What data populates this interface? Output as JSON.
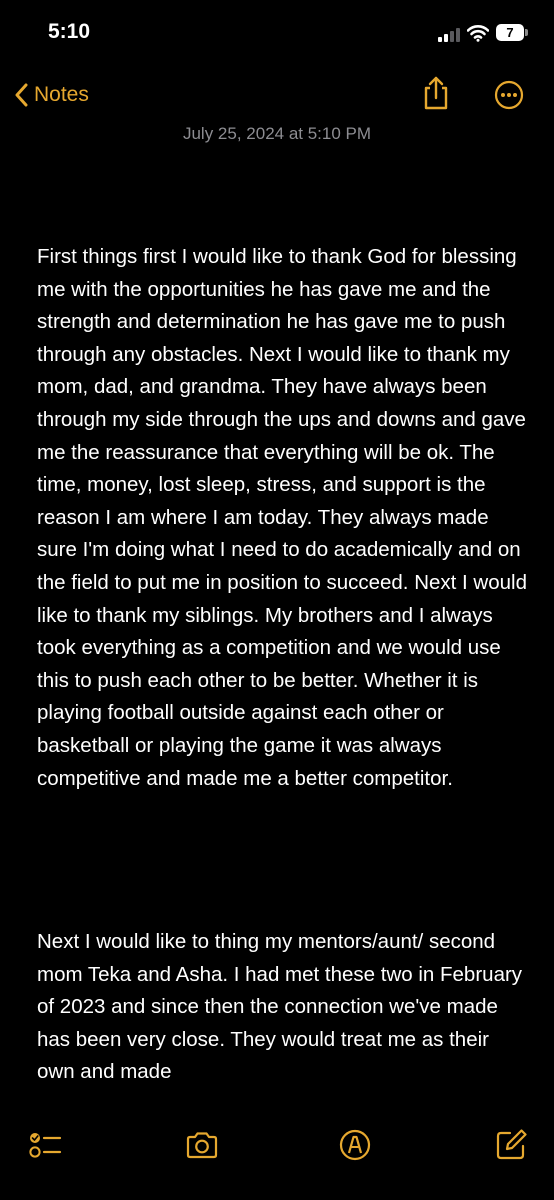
{
  "status_bar": {
    "time": "5:10",
    "battery_level": "7",
    "signal_bars_active": 2,
    "signal_bars_total": 4,
    "icons": [
      "signal-icon",
      "wifi-icon",
      "battery-icon"
    ]
  },
  "nav": {
    "back_label": "Notes",
    "accent_color": "#e6a82f",
    "icons": [
      "chevron-left-icon",
      "share-icon",
      "more-icon"
    ]
  },
  "note": {
    "date": "July 25, 2024 at 5:10 PM",
    "paragraphs": [
      "First things first I would like to thank God for blessing me with the opportunities he has gave me and the strength and determination he has gave me to push through any obstacles. Next I would like to thank my mom, dad, and grandma. They have always been through my side through the ups and downs and gave me the reassurance that everything will be ok. The time, money, lost sleep, stress, and support is the reason I am where I am today. They always made sure I'm doing what I need to do academically and on the field to put me in position to succeed. Next I would like to thank my siblings. My brothers and I always took everything as a competition and we would use this to push each other to be better. Whether it is playing football outside against each other or basketball or playing the game it was always competitive and made me a better competitor.",
      "Next I would like to thing my mentors/aunt/ second mom Teka and Asha. I had met these two in February of 2023 and since then the connection we've made has been very close. They would treat me as their own and made"
    ]
  },
  "toolbar": {
    "icons": [
      "checklist-icon",
      "camera-icon",
      "markup-icon",
      "compose-icon"
    ]
  }
}
